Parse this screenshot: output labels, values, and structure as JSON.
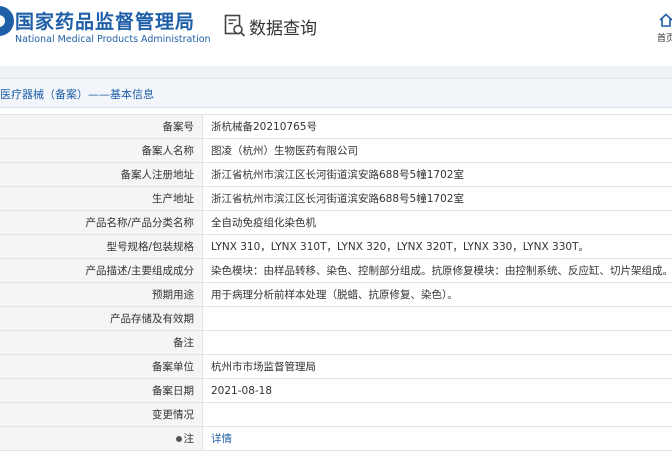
{
  "header": {
    "site_title": "国家药品监督管理局",
    "site_subtitle": "National Medical Products Administration",
    "search_title": "数据查询",
    "home_label": "首页"
  },
  "breadcrumb": "医疗器械（备案）——基本信息",
  "colors": {
    "brand": "#1f5fa8",
    "label_bg": "#f5f5f5",
    "border": "#e3e3e3"
  },
  "rows": [
    {
      "label": "备案号",
      "value": "浙杭械备20210765号"
    },
    {
      "label": "备案人名称",
      "value": "图凌（杭州）生物医药有限公司"
    },
    {
      "label": "备案人注册地址",
      "value": "浙江省杭州市滨江区长河街道滨安路688号5幢1702室"
    },
    {
      "label": "生产地址",
      "value": "浙江省杭州市滨江区长河街道滨安路688号5幢1702室"
    },
    {
      "label": "产品名称/产品分类名称",
      "value": "全自动免疫组化染色机"
    },
    {
      "label": "型号规格/包装规格",
      "value": "LYNX 310，LYNX 310T，LYNX 320，LYNX 320T，LYNX 330，LYNX 330T。"
    },
    {
      "label": "产品描述/主要组成成分",
      "value": "染色模块：由样品转移、染色、控制部分组成。抗原修复模块：由控制系统、反应缸、切片架组成。"
    },
    {
      "label": "预期用途",
      "value": "用于病理分析前样本处理（脱蜡、抗原修复、染色）。"
    },
    {
      "label": "产品存储及有效期",
      "value": ""
    },
    {
      "label": "备注",
      "value": ""
    },
    {
      "label": "备案单位",
      "value": "杭州市市场监督管理局"
    },
    {
      "label": "备案日期",
      "value": "2021-08-18"
    },
    {
      "label": "变更情况",
      "value": ""
    },
    {
      "label": "注",
      "value": "详情"
    }
  ]
}
